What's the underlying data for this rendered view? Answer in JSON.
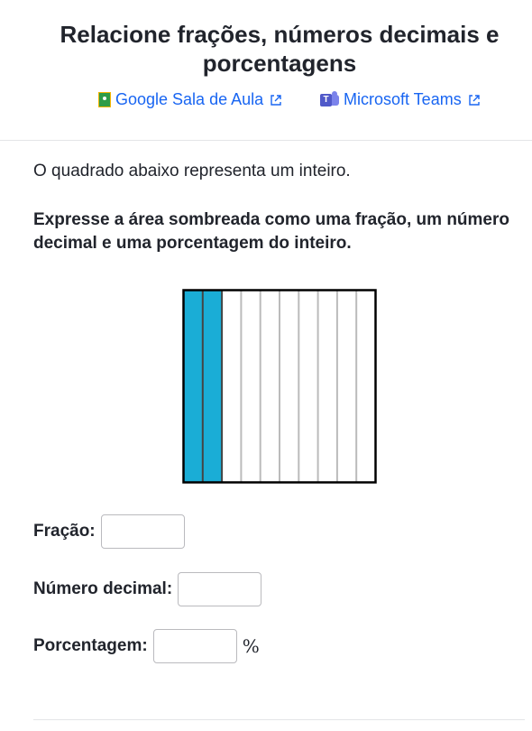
{
  "title": "Relacione frações, números decimais e porcentagens",
  "share": {
    "google_classroom": "Google Sala de Aula",
    "microsoft_teams": "Microsoft Teams"
  },
  "problem": {
    "intro": "O quadrado abaixo representa um inteiro.",
    "question": "Expresse a área sombreada como uma fração, um número decimal e uma porcentagem do inteiro."
  },
  "figure": {
    "total_columns": 10,
    "shaded_columns": 2,
    "shade_color": "#1aadd6",
    "line_color": "#bbbbbb",
    "border_color": "#000000"
  },
  "fields": {
    "fraction_label": "Fração:",
    "fraction_value": "",
    "decimal_label": "Número decimal:",
    "decimal_value": "",
    "percent_label": "Porcentagem:",
    "percent_value": "",
    "percent_suffix": "%"
  },
  "colors": {
    "link": "#1865f2",
    "text": "#21242c"
  }
}
